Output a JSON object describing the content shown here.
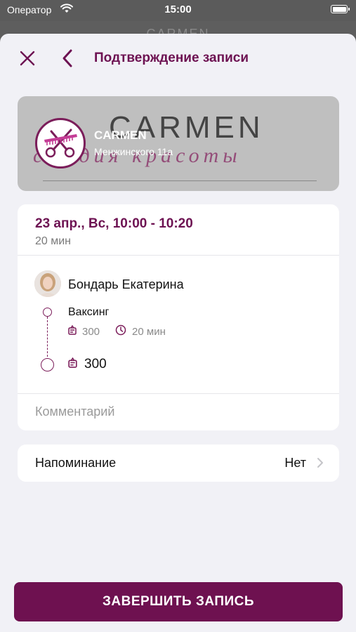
{
  "status_bar": {
    "carrier": "Оператор",
    "time": "15:00"
  },
  "behind_title": "CARMEN",
  "nav": {
    "title": "Подтверждение записи"
  },
  "salon": {
    "name": "CARMEN",
    "address": "Менжинского 11а",
    "banner_word": "CARMEN",
    "banner_sub": "студия красоты"
  },
  "booking": {
    "datetime": "23 апр., Вс, 10:00 - 10:20",
    "duration": "20 мин",
    "master": "Бондарь Екатерина",
    "service": {
      "name": "Ваксинг",
      "price": "300",
      "duration": "20 мин"
    },
    "total": "300",
    "comment_placeholder": "Комментарий"
  },
  "reminder": {
    "label": "Напоминание",
    "value": "Нет"
  },
  "finish_button": "ЗАВЕРШИТЬ ЗАПИСЬ",
  "colors": {
    "accent": "#6e1150",
    "background": "#f1f1f6"
  }
}
